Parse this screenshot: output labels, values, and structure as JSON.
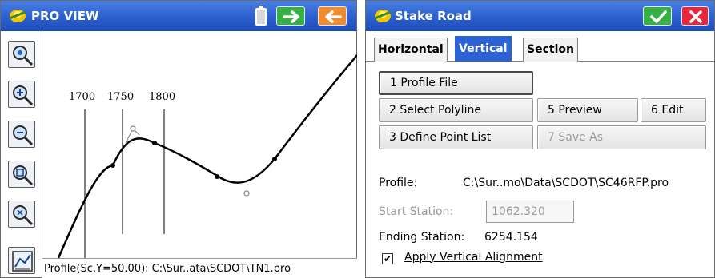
{
  "left_window": {
    "title": "PRO VIEW",
    "titlebar_icons": [
      "battery-icon",
      "forward-arrow-icon",
      "back-arrow-icon"
    ],
    "toolbar": [
      {
        "name": "zoom-all-icon"
      },
      {
        "name": "zoom-in-icon"
      },
      {
        "name": "zoom-out-icon"
      },
      {
        "name": "zoom-window-icon"
      },
      {
        "name": "zoom-previous-icon"
      },
      {
        "name": "profile-graph-icon"
      }
    ],
    "stations": [
      "1700",
      "1750",
      "1800"
    ],
    "status": "Profile(Sc.Y=50.00): C:\\Sur..ata\\SCDOT\\TN1.pro"
  },
  "right_window": {
    "title": "Stake Road",
    "ok_icon": "checkmark-icon",
    "close_icon": "close-x-icon",
    "tabs": [
      {
        "label": "Horizontal",
        "active": false
      },
      {
        "label": "Vertical",
        "active": true
      },
      {
        "label": "Section",
        "active": false
      }
    ],
    "buttons": {
      "profile_file": "1 Profile File",
      "select_polyline": "2 Select Polyline",
      "define_point_list": "3 Define Point List",
      "preview": "5 Preview",
      "edit": "6 Edit",
      "save_as": "7 Save As"
    },
    "profile_label": "Profile:",
    "profile_value": "C:\\Sur..mo\\Data\\SCDOT\\SC46RFP.pro",
    "start_station_label": "Start Station:",
    "start_station_value": "1062.320",
    "ending_station_label": "Ending Station:",
    "ending_station_value": "6254.154",
    "apply_vertical_label": "Apply Vertical Alignment",
    "apply_vertical_checked": "✔"
  },
  "colors": {
    "titlebar": "#2b5fcf",
    "active_tab": "#2c62d6",
    "green_button": "#36b043",
    "orange_button": "#f08a2a",
    "red_button": "#e8283a"
  }
}
